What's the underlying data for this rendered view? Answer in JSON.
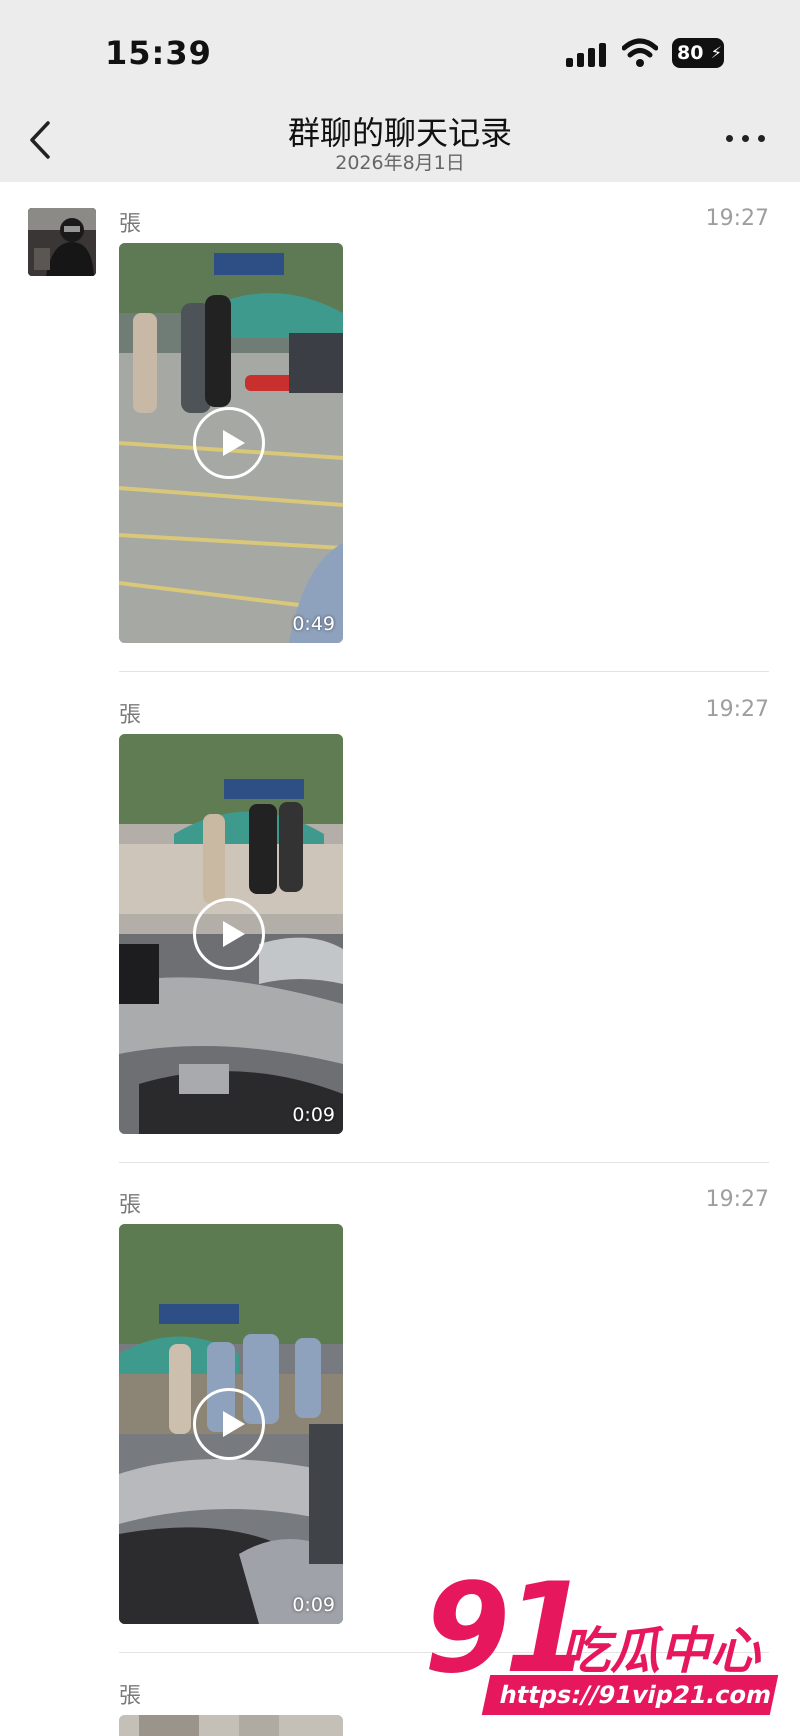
{
  "status_bar": {
    "time": "15:39",
    "battery": "80"
  },
  "nav": {
    "title": "群聊的聊天记录",
    "subtitle": "2026年8月1日"
  },
  "messages": [
    {
      "sender": "張",
      "time": "19:27",
      "duration": "0:49"
    },
    {
      "sender": "張",
      "time": "19:27",
      "duration": "0:09"
    },
    {
      "sender": "張",
      "time": "19:27",
      "duration": "0:09"
    },
    {
      "sender": "張"
    }
  ],
  "watermark": {
    "logo": "91",
    "name": "吃瓜中心",
    "url": "https://91vip21.com"
  },
  "colors": {
    "header_bg": "#ececec",
    "watermark": "#e6175c"
  }
}
